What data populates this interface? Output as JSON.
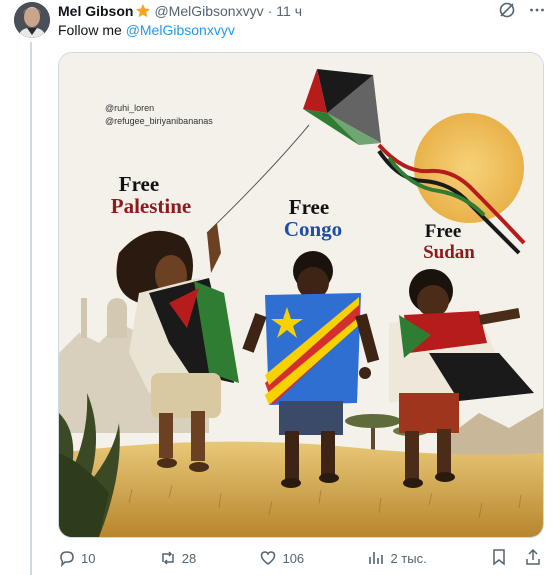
{
  "post": {
    "author_name": "Mel Gibson",
    "handle": "@MelGibsonxvyv",
    "separator": "·",
    "time": "11 ч",
    "text_prefix": "Follow me ",
    "text_mention": "@MelGibsonxvyv"
  },
  "image": {
    "credits": [
      "@ruhi_loren",
      "@refugee_biriyanibananas"
    ],
    "palestine": {
      "line1": "Free",
      "line2": "Palestine"
    },
    "congo": {
      "line1": "Free",
      "line2": "Congo"
    },
    "sudan": {
      "line1": "Free",
      "line2": "Sudan"
    }
  },
  "actions": {
    "replies": "10",
    "reposts": "28",
    "likes": "106",
    "views": "2 тыс."
  },
  "icons": [
    "verified-badge-icon",
    "grok-icon",
    "more-icon",
    "reply-icon",
    "repost-icon",
    "like-icon",
    "views-icon",
    "bookmark-icon",
    "share-icon"
  ],
  "colors": {
    "link": "#1d9bf0",
    "muted": "#536471",
    "badge": "#f4a51c",
    "palestine_red": "#8c1c1c",
    "congo_blue": "#1e4fa3",
    "sudan_red": "#8c1c1c"
  }
}
